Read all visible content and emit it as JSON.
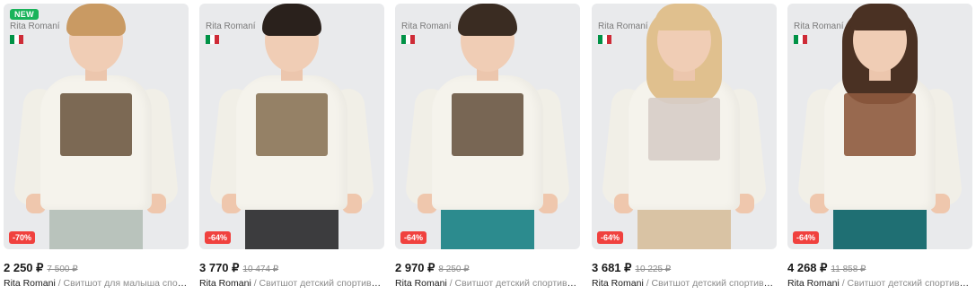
{
  "products": [
    {
      "badge_new": "NEW",
      "brand_overlay": "Rita Romaní",
      "discount": "-70%",
      "price": "2 250 ₽",
      "old_price": "7 500 ₽",
      "brand": "Rita Romani",
      "title": "Свитшот для малыша спортивный",
      "colors": {
        "hair": "#c99a63",
        "pants": "#b9c3bc",
        "print": "#6f5a44"
      }
    },
    {
      "brand_overlay": "Rita Romaní",
      "discount": "-64%",
      "price": "3 770 ₽",
      "old_price": "10 474 ₽",
      "brand": "Rita Romani",
      "title": "Свитшот детский спортивный",
      "colors": {
        "hair": "#2a211c",
        "pants": "#3c3c3e",
        "print": "#8b7458"
      }
    },
    {
      "brand_overlay": "Rita Romaní",
      "discount": "-64%",
      "price": "2 970 ₽",
      "old_price": "8 250 ₽",
      "brand": "Rita Romani",
      "title": "Свитшот детский спортивный",
      "colors": {
        "hair": "#3a2c22",
        "pants": "#2c8b8e",
        "print": "#6a5644"
      }
    },
    {
      "brand_overlay": "Rita Romaní",
      "discount": "-64%",
      "price": "3 681 ₽",
      "old_price": "10 225 ₽",
      "brand": "Rita Romani",
      "title": "Свитшот детский спортивный",
      "colors": {
        "hair": "#e0c08e",
        "pants": "#d9c3a4",
        "print": "#d7cdc8"
      }
    },
    {
      "brand_overlay": "Rita Romaní",
      "discount": "-64%",
      "price": "4 268 ₽",
      "old_price": "11 858 ₽",
      "brand": "Rita Romani",
      "title": "Свитшот детский спортивный",
      "colors": {
        "hair": "#4a3123",
        "pants": "#1f6f73",
        "print": "#8e5a3e"
      }
    }
  ],
  "separator": "/",
  "flag_colors": [
    "#009246",
    "#ffffff",
    "#ce2b37"
  ]
}
